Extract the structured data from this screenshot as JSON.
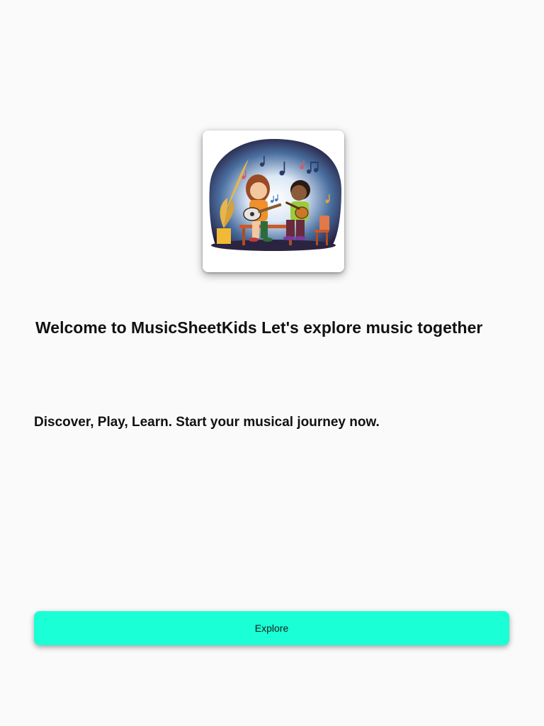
{
  "hero": {
    "illustration": "two-kids-playing-guitars-illustration"
  },
  "welcome": {
    "title": "Welcome to MusicSheetKids Let's explore music together"
  },
  "intro": {
    "tagline": "Discover, Play, Learn. Start your musical journey now."
  },
  "actions": {
    "explore_label": "Explore"
  },
  "colors": {
    "background": "#fafafa",
    "button": "#1affd5",
    "text": "#111111"
  }
}
